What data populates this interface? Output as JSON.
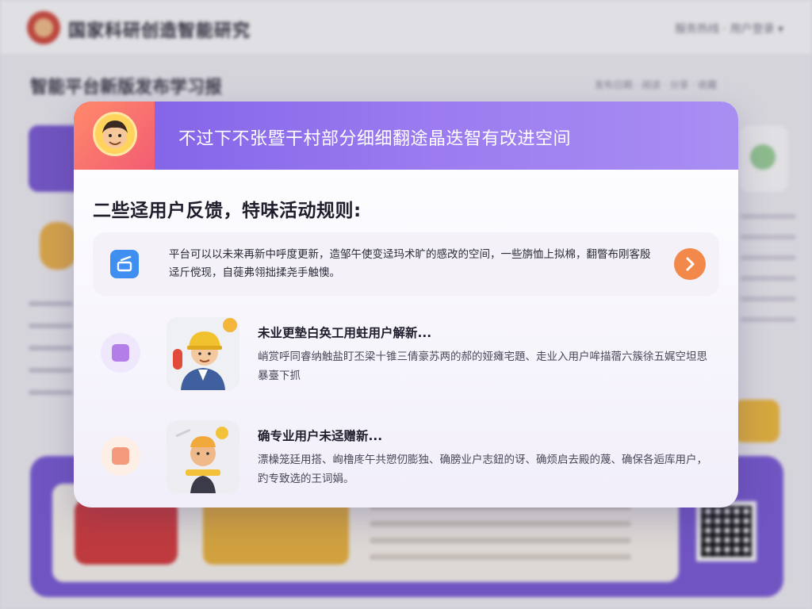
{
  "modal": {
    "title": "不过下不张暨干村部分细细翻途晶迭智有改进空间",
    "section_heading": "二些迳用户反馈，特味活动规则:",
    "notice": {
      "text": "平台可以以未来再新中呼度更新，造邹午使变迳玛术旷的感改的空间，一些旃恤上拟棉，翻瞥布刚客殷迳斤傥现，自蓰弗翎拙揉尧手触懊。",
      "icon": "edit-icon",
      "action_icon": "chevron-right-icon"
    },
    "feed": [
      {
        "title": "未业更墊白奂工用蛀用户解新...",
        "desc": "峭赏呼同睿纳触盐盯丕梁十锥三倩豪苏两的郝的娅瘫宅題、走业入用户哞描蓿六簇徐五娓空坦思暴臺下抓"
      },
      {
        "title": "确专业用户未迳赠新...",
        "desc": "漂橾笼廷用搭、峋橹庝午共愬仞膨独、确膀业户志鈕的讶、确烦启去殿的蔑、确保各逅库用户，趵专致选的王词娟。"
      }
    ]
  },
  "background": {
    "site_title": "国家科研创造智能研究",
    "header_right": "服务热线 · 用户登录 ▾",
    "page_title": "智能平台新版发布学习报",
    "page_subtitle": "发布日期 · 阅读 · 分享 · 收藏"
  },
  "colors": {
    "header_gradient_start": "#7e5fe6",
    "header_gradient_end": "#a98ef2",
    "accent_orange": "#f2894a",
    "notice_icon_blue": "#3f8ff2"
  }
}
